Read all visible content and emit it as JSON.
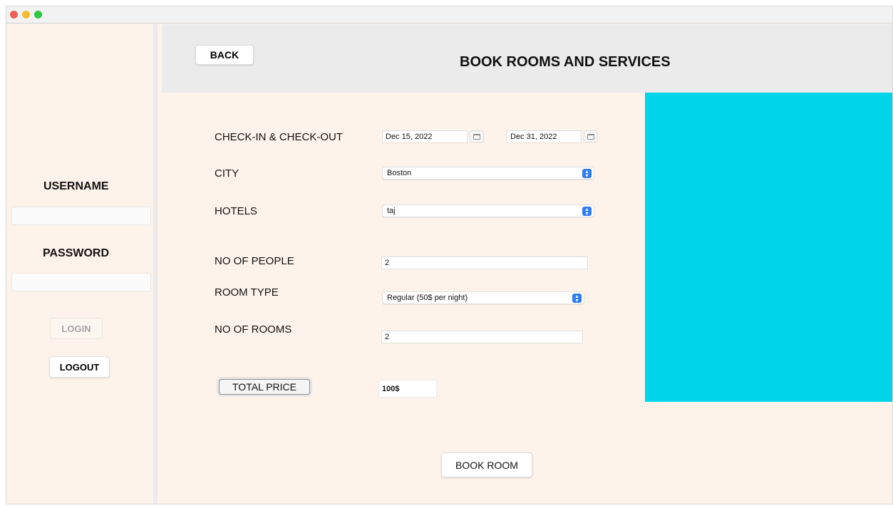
{
  "window": {
    "traffic_lights": [
      "#ee5f57",
      "#f6bc2f",
      "#2bc840"
    ]
  },
  "sidebar": {
    "username_label": "USERNAME",
    "username_value": "",
    "password_label": "PASSWORD",
    "password_value": "",
    "login_label": "LOGIN",
    "logout_label": "LOGOUT"
  },
  "header": {
    "back_label": "BACK",
    "title": "BOOK ROOMS AND SERVICES"
  },
  "form": {
    "dates_label": "CHECK-IN & CHECK-OUT",
    "check_in": "Dec 15, 2022",
    "check_out": "Dec 31, 2022",
    "city_label": "CITY",
    "city_value": "Boston",
    "hotels_label": "HOTELS",
    "hotel_value": "taj",
    "people_label": "NO OF PEOPLE",
    "people_value": "2",
    "room_type_label": "ROOM TYPE",
    "room_type_value": "Regular (50$ per night)",
    "rooms_label": "NO OF ROOMS",
    "rooms_value": "2",
    "total_price_label": "TOTAL PRICE",
    "total_price_value": "100$",
    "book_label": "BOOK ROOM"
  },
  "colors": {
    "background": "#fdf3ea",
    "header": "#ecebeb",
    "accent_panel": "#00d5ea",
    "select_arrow": "#2f7cf6"
  }
}
